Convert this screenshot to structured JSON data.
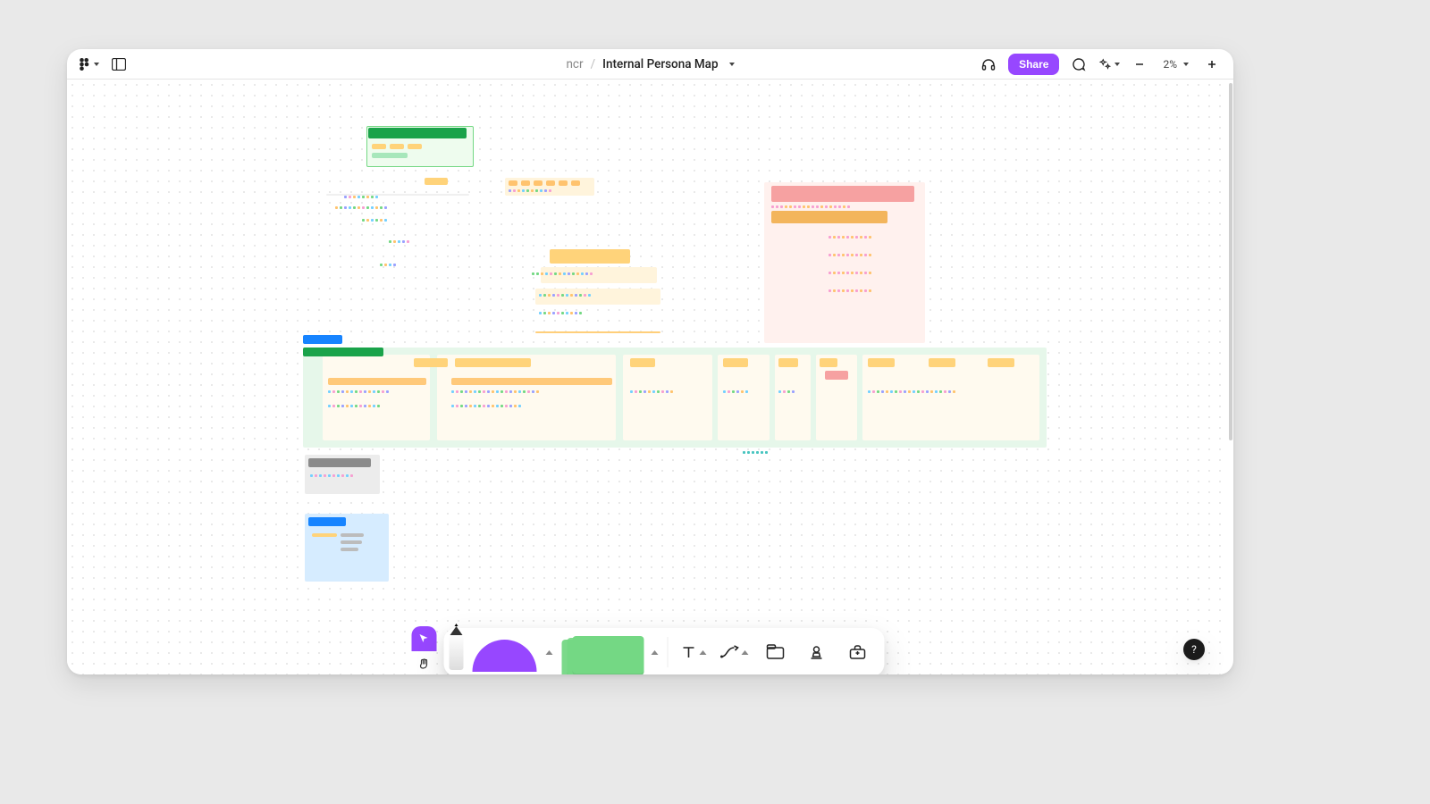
{
  "header": {
    "project": "ncr",
    "doc_title": "Internal Persona Map",
    "share_label": "Share",
    "zoom_label": "2%"
  },
  "toolbar": {
    "figma_menu": "figma-menu",
    "panels": "layout-panels",
    "headphones": "audio",
    "comments": "comments",
    "ai": "ai-tools",
    "zoom_out": "−",
    "zoom_in": "+"
  },
  "dock": {
    "select": "select-tool",
    "hand": "hand-tool",
    "pen": "marker-tool",
    "shape": "shape-tool",
    "sticky": "sticky-note",
    "text": "text-tool",
    "connector": "connector-tool",
    "section": "section-tool",
    "stamp": "stamp-tool",
    "widgets": "widgets-tool"
  },
  "help": {
    "label": "?"
  }
}
